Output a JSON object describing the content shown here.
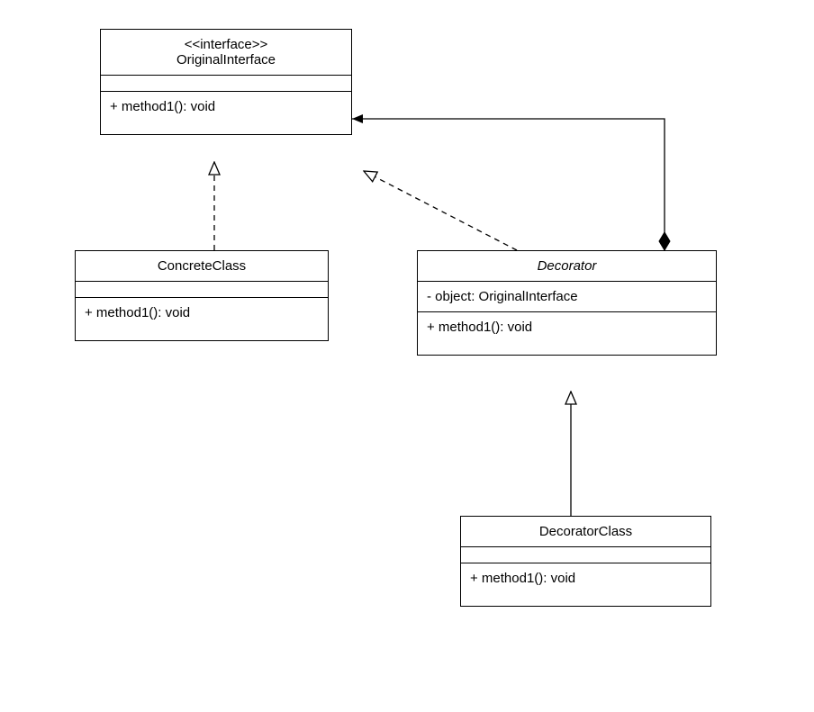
{
  "diagram": {
    "originalInterface": {
      "stereotype": "<<interface>>",
      "name": "OriginalInterface",
      "method": "+ method1(): void"
    },
    "concreteClass": {
      "name": "ConcreteClass",
      "method": "+ method1(): void"
    },
    "decorator": {
      "name": "Decorator",
      "attribute": "- object: OriginalInterface",
      "method": "+ method1(): void"
    },
    "decoratorClass": {
      "name": "DecoratorClass",
      "method": "+ method1(): void"
    }
  },
  "chart_data": {
    "type": "table",
    "description": "UML class diagram for Decorator pattern",
    "classes": [
      {
        "name": "OriginalInterface",
        "stereotype": "interface",
        "attributes": [],
        "methods": [
          "+ method1(): void"
        ]
      },
      {
        "name": "ConcreteClass",
        "attributes": [],
        "methods": [
          "+ method1(): void"
        ]
      },
      {
        "name": "Decorator",
        "abstract": true,
        "attributes": [
          "- object: OriginalInterface"
        ],
        "methods": [
          "+ method1(): void"
        ]
      },
      {
        "name": "DecoratorClass",
        "attributes": [],
        "methods": [
          "+ method1(): void"
        ]
      }
    ],
    "relationships": [
      {
        "from": "ConcreteClass",
        "to": "OriginalInterface",
        "type": "realization"
      },
      {
        "from": "Decorator",
        "to": "OriginalInterface",
        "type": "realization"
      },
      {
        "from": "Decorator",
        "to": "OriginalInterface",
        "type": "composition"
      },
      {
        "from": "DecoratorClass",
        "to": "Decorator",
        "type": "inheritance"
      }
    ]
  }
}
